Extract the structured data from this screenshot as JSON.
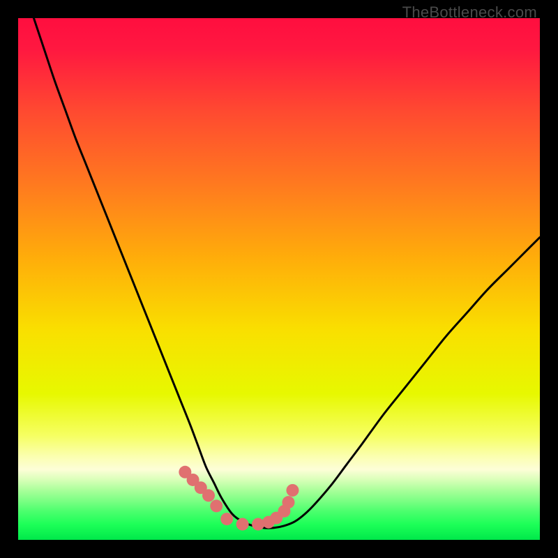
{
  "watermark": "TheBottleneck.com",
  "chart_data": {
    "type": "line",
    "title": "",
    "xlabel": "",
    "ylabel": "",
    "ylim": [
      0,
      100
    ],
    "xlim": [
      0,
      100
    ],
    "curve": {
      "x": [
        3,
        5,
        7,
        9,
        11,
        13,
        15,
        17,
        19,
        21,
        23,
        25,
        27,
        29,
        31,
        33,
        34.5,
        36,
        37.5,
        39,
        41,
        43,
        45,
        47,
        49,
        51,
        53,
        55,
        57,
        60,
        63,
        66,
        70,
        74,
        78,
        82,
        86,
        90,
        94,
        98,
        100
      ],
      "y": [
        100,
        94,
        88,
        82.5,
        77,
        72,
        67,
        62,
        57,
        52,
        47,
        42,
        37,
        32,
        27,
        22,
        18,
        14,
        11,
        8,
        5,
        3.5,
        2.7,
        2.3,
        2.3,
        2.7,
        3.5,
        5,
        7,
        10.5,
        14.5,
        18.5,
        24,
        29,
        34,
        39,
        43.5,
        48,
        52,
        56,
        58
      ]
    },
    "markers": {
      "x": [
        32,
        33.5,
        35,
        36.5,
        38,
        40,
        43,
        46,
        48,
        49.5,
        51,
        51.8,
        52.6
      ],
      "y": [
        13,
        11.5,
        10,
        8.5,
        6.5,
        4,
        3,
        3,
        3.4,
        4.2,
        5.5,
        7.2,
        9.5
      ]
    },
    "gradient_stops": [
      {
        "offset": 0.0,
        "color": "#ff0e3f"
      },
      {
        "offset": 0.06,
        "color": "#ff1840"
      },
      {
        "offset": 0.18,
        "color": "#ff4a30"
      },
      {
        "offset": 0.32,
        "color": "#ff7a1f"
      },
      {
        "offset": 0.46,
        "color": "#ffad0a"
      },
      {
        "offset": 0.6,
        "color": "#f9e000"
      },
      {
        "offset": 0.72,
        "color": "#e7f800"
      },
      {
        "offset": 0.8,
        "color": "#f6ff62"
      },
      {
        "offset": 0.84,
        "color": "#fbffb0"
      },
      {
        "offset": 0.865,
        "color": "#fdfed7"
      },
      {
        "offset": 0.885,
        "color": "#d8ffb8"
      },
      {
        "offset": 0.905,
        "color": "#a9ff9a"
      },
      {
        "offset": 0.925,
        "color": "#7cff84"
      },
      {
        "offset": 0.945,
        "color": "#4cff6e"
      },
      {
        "offset": 0.97,
        "color": "#1dff58"
      },
      {
        "offset": 1.0,
        "color": "#00e84a"
      }
    ],
    "curve_color": "#000000",
    "marker_color": "#e07070",
    "marker_radius": 9
  }
}
